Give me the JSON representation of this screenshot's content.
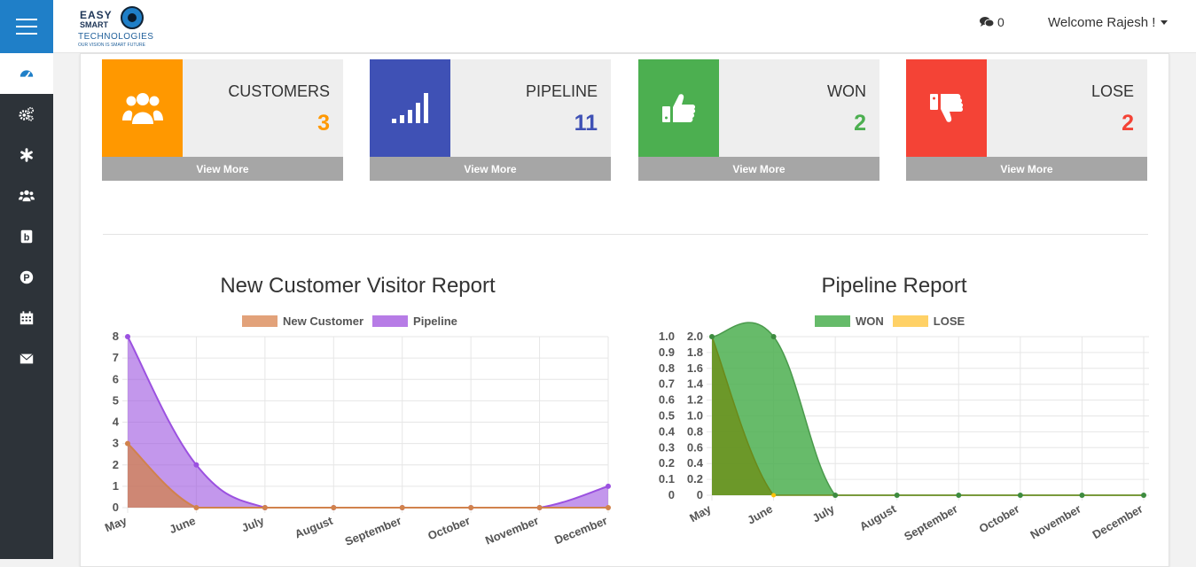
{
  "header": {
    "logo": {
      "line1": "EASY",
      "line2": "SMART",
      "line3": "TECHNOLOGIES",
      "line4": "OUR VISION IS SMART FUTURE"
    },
    "notifications_count": "0",
    "welcome": "Welcome Rajesh !"
  },
  "sidebar": {
    "items": [
      {
        "icon": "dashboard-icon",
        "active": true
      },
      {
        "icon": "gears-icon",
        "active": false
      },
      {
        "icon": "asterisk-icon",
        "active": false
      },
      {
        "icon": "users-icon",
        "active": false
      },
      {
        "icon": "product-icon",
        "active": false
      },
      {
        "icon": "p-circle-icon",
        "active": false
      },
      {
        "icon": "calendar-icon",
        "active": false
      },
      {
        "icon": "envelope-icon",
        "active": false
      }
    ]
  },
  "cards": [
    {
      "label": "CUSTOMERS",
      "value": "3",
      "more": "View More",
      "color": "#ff9800",
      "icon": "users-icon"
    },
    {
      "label": "PIPELINE",
      "value": "11",
      "more": "View More",
      "color": "#3f51b5",
      "icon": "signal-icon"
    },
    {
      "label": "WON",
      "value": "2",
      "more": "View More",
      "color": "#4caf50",
      "icon": "thumbs-up-icon"
    },
    {
      "label": "LOSE",
      "value": "2",
      "more": "View More",
      "color": "#f44336",
      "icon": "thumbs-down-icon"
    }
  ],
  "chart_data": [
    {
      "type": "area",
      "title": "New Customer Visitor Report",
      "categories": [
        "May",
        "June",
        "July",
        "August",
        "September",
        "October",
        "November",
        "December"
      ],
      "ylim": [
        0,
        8
      ],
      "grid": true,
      "legend_position": "top",
      "series": [
        {
          "name": "New Customer",
          "values": [
            3,
            0,
            0,
            0,
            0,
            0,
            0,
            0
          ],
          "color": "#d1824c"
        },
        {
          "name": "Pipeline",
          "values": [
            8,
            2,
            0,
            0,
            0,
            0,
            0,
            1
          ],
          "color": "#9b51e0"
        }
      ],
      "yticks": [
        "0",
        "1",
        "2",
        "3",
        "4",
        "5",
        "6",
        "7",
        "8"
      ]
    },
    {
      "type": "area",
      "title": "Pipeline Report",
      "categories": [
        "May",
        "June",
        "July",
        "August",
        "September",
        "October",
        "November",
        "December"
      ],
      "grid": true,
      "legend_position": "top",
      "series": [
        {
          "name": "WON",
          "values": [
            2,
            2,
            0,
            0,
            0,
            0,
            0,
            0
          ],
          "color": "#4caf50"
        },
        {
          "name": "LOSE",
          "values": [
            1,
            0,
            0,
            0,
            0,
            0,
            0,
            0
          ],
          "color": "#ffc107"
        }
      ],
      "yticks_left": [
        "0",
        "0.1",
        "0.2",
        "0.3",
        "0.4",
        "0.5",
        "0.6",
        "0.7",
        "0.8",
        "0.9",
        "1.0"
      ],
      "yticks_right": [
        "0",
        "0.2",
        "0.4",
        "0.6",
        "0.8",
        "1.0",
        "1.2",
        "1.4",
        "1.6",
        "1.8",
        "2.0"
      ],
      "ylim_left": [
        0,
        1
      ],
      "ylim_right": [
        0,
        2
      ]
    }
  ]
}
